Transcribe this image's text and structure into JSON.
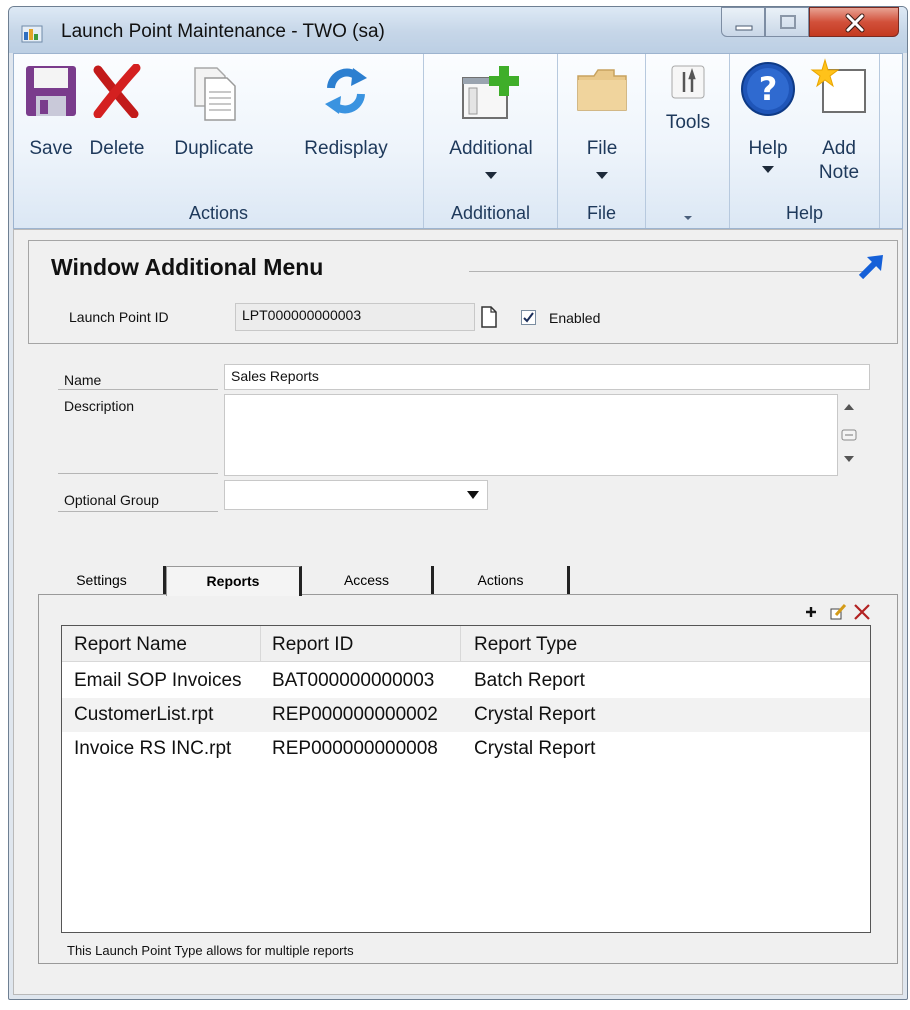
{
  "window": {
    "title": "Launch Point Maintenance  -  TWO (sa)"
  },
  "ribbon": {
    "actions": {
      "group_label": "Actions",
      "save": "Save",
      "delete": "Delete",
      "duplicate": "Duplicate",
      "redisplay": "Redisplay"
    },
    "additional": {
      "group_label": "Additional",
      "button": "Additional"
    },
    "file": {
      "group_label": "File",
      "button": "File"
    },
    "tools": {
      "button": "Tools"
    },
    "help": {
      "group_label": "Help",
      "help_button": "Help",
      "add_note_line1": "Add",
      "add_note_line2": "Note"
    }
  },
  "header": {
    "title": "Window Additional Menu",
    "launch_point_id_label": "Launch Point  ID",
    "launch_point_id_value": "LPT000000000003",
    "enabled_label": "Enabled",
    "enabled": true
  },
  "form": {
    "name_label": "Name",
    "name_value": "Sales Reports",
    "description_label": "Description",
    "description_value": "",
    "optional_group_label": "Optional Group",
    "optional_group_value": ""
  },
  "tabs": [
    {
      "label": "Settings",
      "active": false
    },
    {
      "label": "Reports",
      "active": true
    },
    {
      "label": "Access",
      "active": false
    },
    {
      "label": "Actions",
      "active": false
    }
  ],
  "reports": {
    "columns": [
      "Report Name",
      "Report ID",
      "Report Type"
    ],
    "rows": [
      [
        "Email SOP Invoices",
        "BAT000000000003",
        "Batch Report"
      ],
      [
        "CustomerList.rpt",
        "REP000000000002",
        "Crystal Report"
      ],
      [
        "Invoice RS INC.rpt",
        "REP000000000008",
        "Crystal Report"
      ]
    ],
    "footnote": "This Launch Point Type allows for multiple reports"
  },
  "colors": {
    "ribbon_text": "#1e395b",
    "close_red": "#c43a20",
    "accent_blue": "#1560d8"
  }
}
